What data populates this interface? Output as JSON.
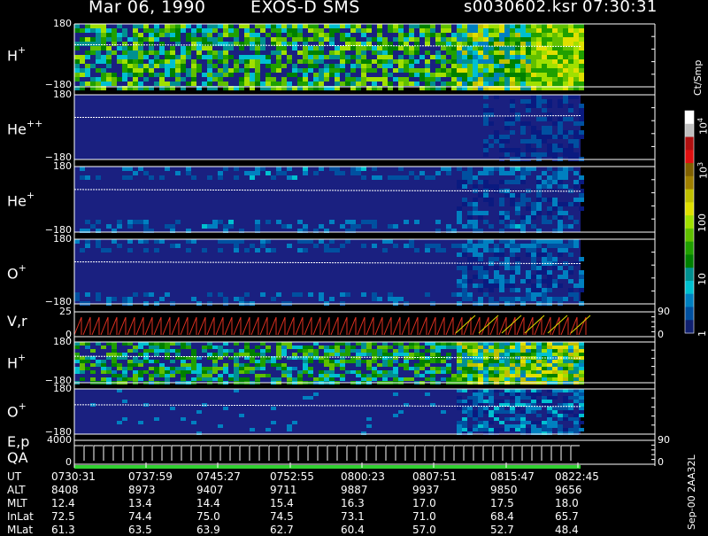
{
  "header": {
    "date": "Mar 06, 1990",
    "instrument": "EXOS-D SMS",
    "file": "s0030602.ksr",
    "time": "07:30:31"
  },
  "panels": [
    {
      "label_main": "H",
      "label_sup": "+",
      "top": "180",
      "bottom": "−180"
    },
    {
      "label_main": "He",
      "label_sup": "++",
      "top": "180",
      "bottom": "−180"
    },
    {
      "label_main": "He",
      "label_sup": "+",
      "top": "180",
      "bottom": "−180"
    },
    {
      "label_main": "O",
      "label_sup": "+",
      "top": "180",
      "bottom": "−180"
    },
    {
      "label_main": "V",
      "label_sup": "",
      "label_suffix": ",r",
      "top": "25",
      "bottom": "0",
      "right_top": "90",
      "right_bottom": "0"
    },
    {
      "label_main": "H",
      "label_sup": "+",
      "top": "180",
      "bottom": "−180"
    },
    {
      "label_main": "O",
      "label_sup": "+",
      "top": "180",
      "bottom": "−180"
    },
    {
      "label_main": "E",
      "label_suffix": ",p",
      "label2": "QA",
      "top": "4000",
      "bottom": "0",
      "right_top": "90",
      "right_bottom": "0"
    }
  ],
  "colorbar": {
    "unit": "Ct/Smp",
    "ticks": [
      {
        "base": "10",
        "exp": "4"
      },
      {
        "base": "10",
        "exp": "3"
      },
      {
        "base": "100",
        "exp": ""
      },
      {
        "base": "10",
        "exp": ""
      },
      {
        "base": "1",
        "exp": ""
      }
    ],
    "colors": [
      "#ffffff",
      "#c0c0c0",
      "#b01010",
      "#e01010",
      "#806000",
      "#a08000",
      "#c0c000",
      "#e0e000",
      "#a0e000",
      "#60c000",
      "#20a000",
      "#008000",
      "#009090",
      "#00c0d0",
      "#0080c0",
      "#0050a0",
      "#102070"
    ]
  },
  "footer": {
    "row_names": [
      "UT",
      "ALT",
      "MLT",
      "InLat",
      "MLat"
    ],
    "columns": [
      {
        "UT": "0730:31",
        "ALT": "8408",
        "MLT": "12.4",
        "InLat": "72.5",
        "MLat": "61.3"
      },
      {
        "UT": "0737:59",
        "ALT": "8973",
        "MLT": "13.4",
        "InLat": "74.4",
        "MLat": "63.5"
      },
      {
        "UT": "0745:27",
        "ALT": "9407",
        "MLT": "14.4",
        "InLat": "75.0",
        "MLat": "63.9"
      },
      {
        "UT": "0752:55",
        "ALT": "9711",
        "MLT": "15.4",
        "InLat": "74.5",
        "MLat": "62.7"
      },
      {
        "UT": "0800:23",
        "ALT": "9887",
        "MLT": "16.3",
        "InLat": "73.1",
        "MLat": "60.4"
      },
      {
        "UT": "0807:51",
        "ALT": "9937",
        "MLT": "17.0",
        "InLat": "71.0",
        "MLat": "57.0"
      },
      {
        "UT": "0815:47",
        "ALT": "9850",
        "MLT": "17.5",
        "InLat": "68.4",
        "MLat": "52.7"
      },
      {
        "UT": "0822:45",
        "ALT": "9656",
        "MLT": "18.0",
        "InLat": "65.7",
        "MLat": "48.4"
      }
    ],
    "version": "Sep-00  2AA32L"
  },
  "chart_data": {
    "type": "heatmap",
    "title": "Mar 06, 1990   EXOS-D SMS",
    "x_ticks": [
      "0730:31",
      "0737:59",
      "0745:27",
      "0752:55",
      "0800:23",
      "0807:51",
      "0815:47",
      "0822:45"
    ],
    "xlabel": "UT",
    "panels": [
      "H+",
      "He++",
      "He+",
      "O+",
      "V,r",
      "H+",
      "O+",
      "E,p QA"
    ],
    "y_range_pitch": [
      -180,
      180
    ],
    "colorbar_unit": "Ct/Smp",
    "colorbar_ticks": [
      "1",
      "10",
      "100",
      "10^3",
      "10^4"
    ]
  }
}
